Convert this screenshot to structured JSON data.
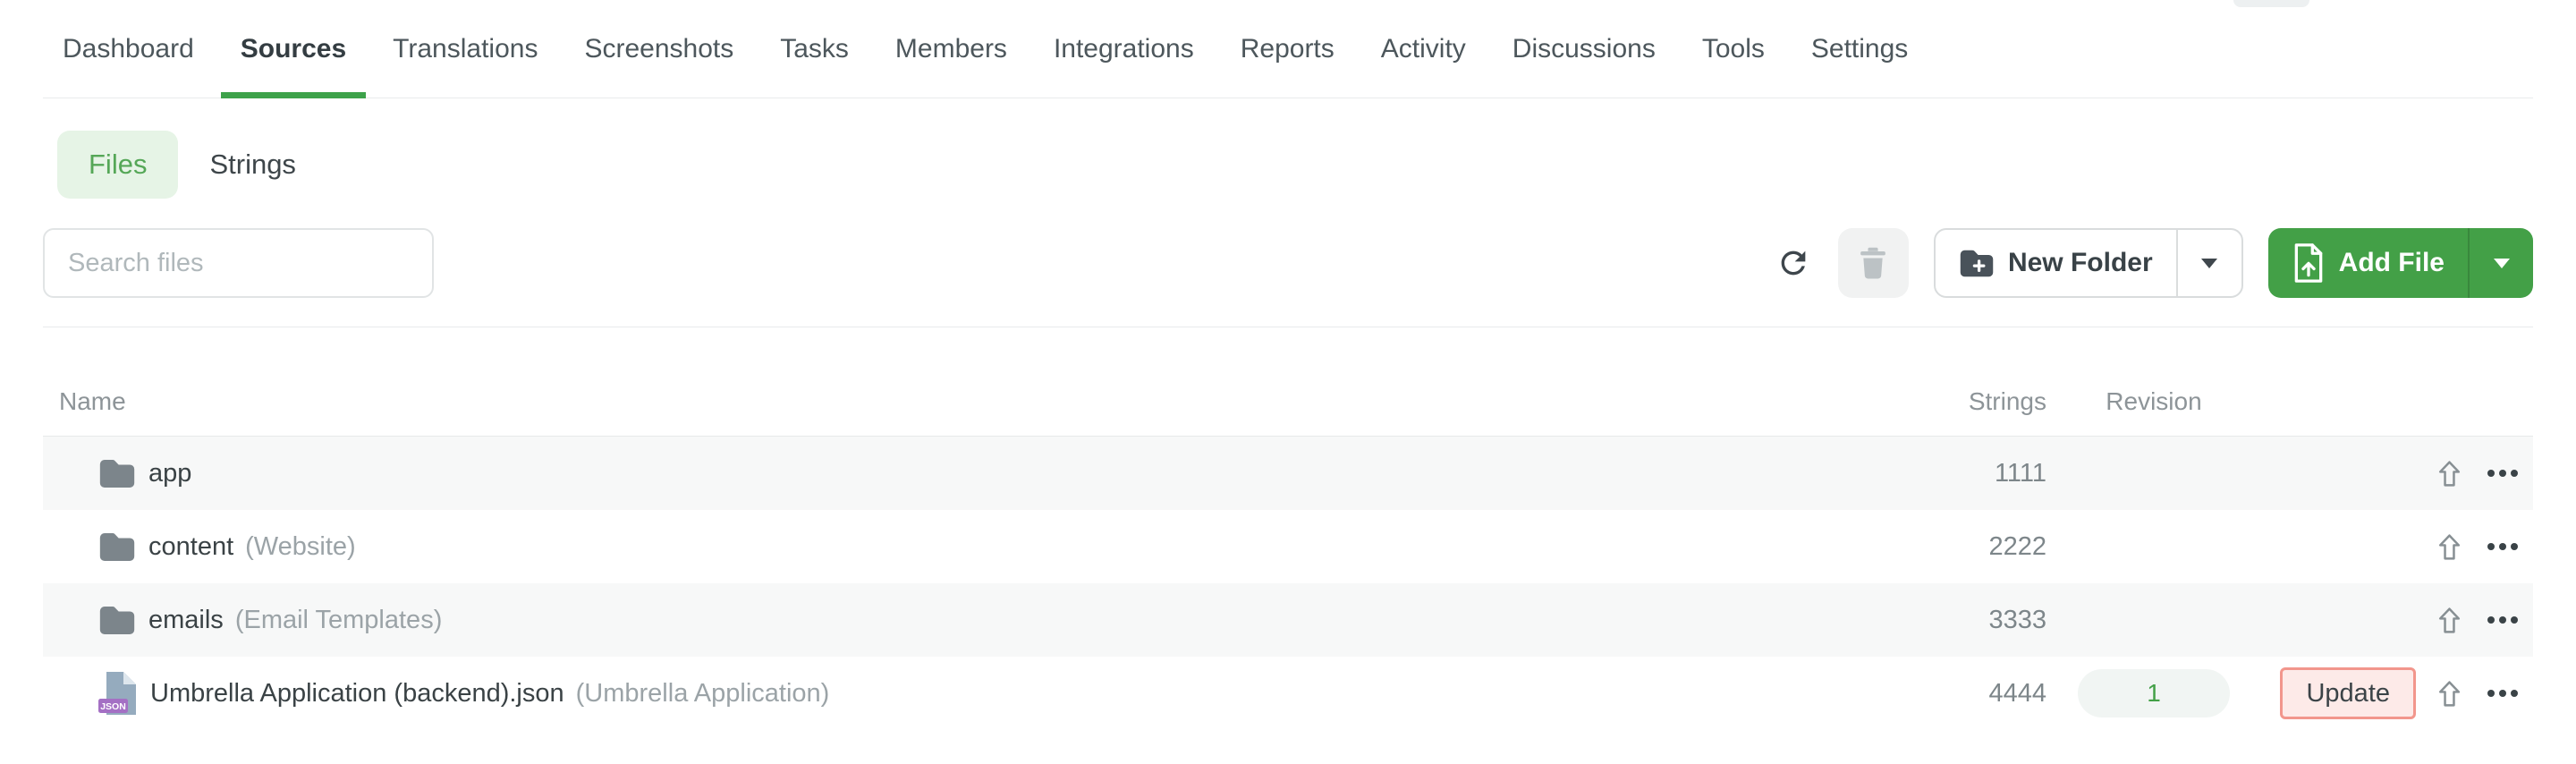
{
  "nav": {
    "tabs": [
      {
        "label": "Dashboard",
        "active": false
      },
      {
        "label": "Sources",
        "active": true
      },
      {
        "label": "Translations",
        "active": false
      },
      {
        "label": "Screenshots",
        "active": false
      },
      {
        "label": "Tasks",
        "active": false
      },
      {
        "label": "Members",
        "active": false
      },
      {
        "label": "Integrations",
        "active": false
      },
      {
        "label": "Reports",
        "active": false
      },
      {
        "label": "Activity",
        "active": false
      },
      {
        "label": "Discussions",
        "active": false
      },
      {
        "label": "Tools",
        "active": false
      },
      {
        "label": "Settings",
        "active": false
      }
    ]
  },
  "view_switcher": {
    "files_label": "Files",
    "strings_label": "Strings",
    "active_view": "Files"
  },
  "toolbar": {
    "search_placeholder": "Search files",
    "refresh_icon": "refresh-icon",
    "delete_icon": "trash-icon",
    "new_folder_label": "New Folder",
    "new_folder_icon": "folder-plus-icon",
    "add_file_label": "Add File",
    "add_file_icon": "file-upload-icon",
    "dropdown_icon": "caret-down-icon"
  },
  "table": {
    "columns": {
      "name": "Name",
      "strings": "Strings",
      "revision": "Revision"
    },
    "row_action_icons": [
      "upload-icon",
      "ellipsis-icon"
    ],
    "rows": [
      {
        "type": "folder",
        "icon": "folder-icon",
        "name": "app",
        "note": "",
        "strings": "1111",
        "revision": "",
        "expandable": true
      },
      {
        "type": "folder",
        "icon": "folder-icon",
        "name": "content",
        "note": "(Website)",
        "strings": "2222",
        "revision": "",
        "expandable": true
      },
      {
        "type": "folder",
        "icon": "folder-icon",
        "name": "emails",
        "note": "(Email Templates)",
        "strings": "3333",
        "revision": "",
        "expandable": true
      },
      {
        "type": "file",
        "icon": "json-file-icon",
        "file_badge": "JSON",
        "name": "Umbrella Application (backend).json",
        "note": "(Umbrella Application)",
        "strings": "4444",
        "revision": "1",
        "update_label": "Update",
        "update_highlighted": true
      }
    ]
  },
  "colors": {
    "accent_green": "#43a047",
    "active_tab_underline": "#3da24a",
    "files_chip_bg": "#e6f4e6",
    "files_chip_text": "#55a757",
    "add_file_button_bg": "#43a047",
    "row_alt_bg": "#f7f8f8",
    "revision_badge_text": "#43a047",
    "update_highlight_border": "#f2968c",
    "update_highlight_bg": "#fdeae8",
    "json_badge_bg": "#a470c4"
  }
}
